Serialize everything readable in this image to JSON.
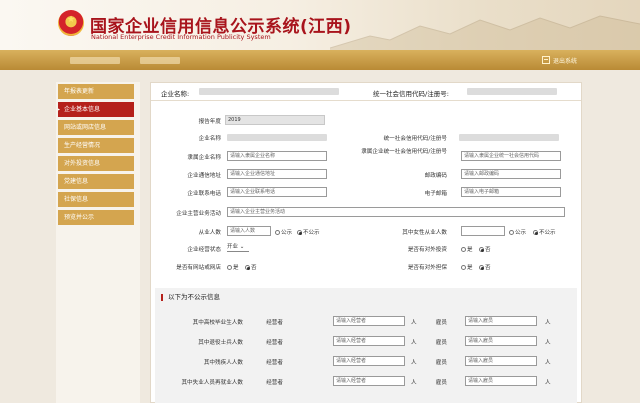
{
  "header": {
    "title_cn": "国家企业信用信息公示系统(江西)",
    "title_en": "National Enterprise Credit Information Publicity System"
  },
  "topbar": {
    "left_link": "",
    "right_link": "退出系统"
  },
  "sidebar": {
    "items": [
      {
        "label": "年报表更新"
      },
      {
        "label": "企业基本信息"
      },
      {
        "label": "网站或网店信息"
      },
      {
        "label": "生产经营情况"
      },
      {
        "label": "对外投资信息"
      },
      {
        "label": "党建信息"
      },
      {
        "label": "社保信息"
      },
      {
        "label": "预览并公示"
      }
    ]
  },
  "enterprise": {
    "name_label": "企业名称:",
    "code_label": "统一社会信用代码/注册号:"
  },
  "form": {
    "report_year_label": "报告年度",
    "report_year_value": "2019",
    "company_name_label": "企业名称",
    "credit_code_label": "统一社会信用代码/注册号",
    "affiliate_name_label": "隶属企业名称",
    "affiliate_name_placeholder": "请输入隶属企业名称",
    "affiliate_code_label": "隶属企业统一社会信用代码/注册号",
    "affiliate_code_placeholder": "请输入隶属企业统一社会信用代码",
    "address_label": "企业通信地址",
    "address_placeholder": "请输入企业通信地址",
    "postcode_label": "邮政编码",
    "postcode_placeholder": "请输入邮政编码",
    "phone_label": "企业联系电话",
    "phone_placeholder": "请输入企业联系电话",
    "email_label": "电子邮箱",
    "email_placeholder": "请输入电子邮箱",
    "main_business_label": "企业主营业务活动",
    "main_business_placeholder": "请输入企业主营业务活动",
    "employees_label": "从业人数",
    "employees_placeholder": "请输入人数",
    "employees_public": "公示",
    "employees_private": "不公示",
    "female_label": "其中女性从业人数",
    "female_public": "公示",
    "female_private": "不公示",
    "status_label": "企业经营状态",
    "status_value": "开业",
    "holding_label": "是否有对外投资",
    "holding_yes": "是",
    "holding_no": "否",
    "website_label": "是否有网站或网店",
    "website_yes": "是",
    "website_no": "否",
    "guarantee_label": "是否有对外担保",
    "guarantee_yes": "是",
    "guarantee_no": "否"
  },
  "section": {
    "title": "以下为不公示信息",
    "rows": [
      {
        "label": "其中高校毕业生人数",
        "manager_label": "经营者",
        "manager_placeholder": "请输入经营者",
        "unit1": "人",
        "employee_label": "雇员",
        "employee_placeholder": "请输入雇员",
        "unit2": "人"
      },
      {
        "label": "其中退役士兵人数",
        "manager_label": "经营者",
        "manager_placeholder": "请输入经营者",
        "unit1": "人",
        "employee_label": "雇员",
        "employee_placeholder": "请输入雇员",
        "unit2": "人"
      },
      {
        "label": "其中残疾人人数",
        "manager_label": "经营者",
        "manager_placeholder": "请输入经营者",
        "unit1": "人",
        "employee_label": "雇员",
        "employee_placeholder": "请输入雇员",
        "unit2": "人"
      },
      {
        "label": "其中失业人员再就业人数",
        "manager_label": "经营者",
        "manager_placeholder": "请输入经营者",
        "unit1": "人",
        "employee_label": "雇员",
        "employee_placeholder": "请输入雇员",
        "unit2": "人"
      }
    ]
  },
  "colors": {
    "brand_red": "#a8141c",
    "sidebar_gold": "#d4a54f",
    "sidebar_active": "#b5211b"
  }
}
